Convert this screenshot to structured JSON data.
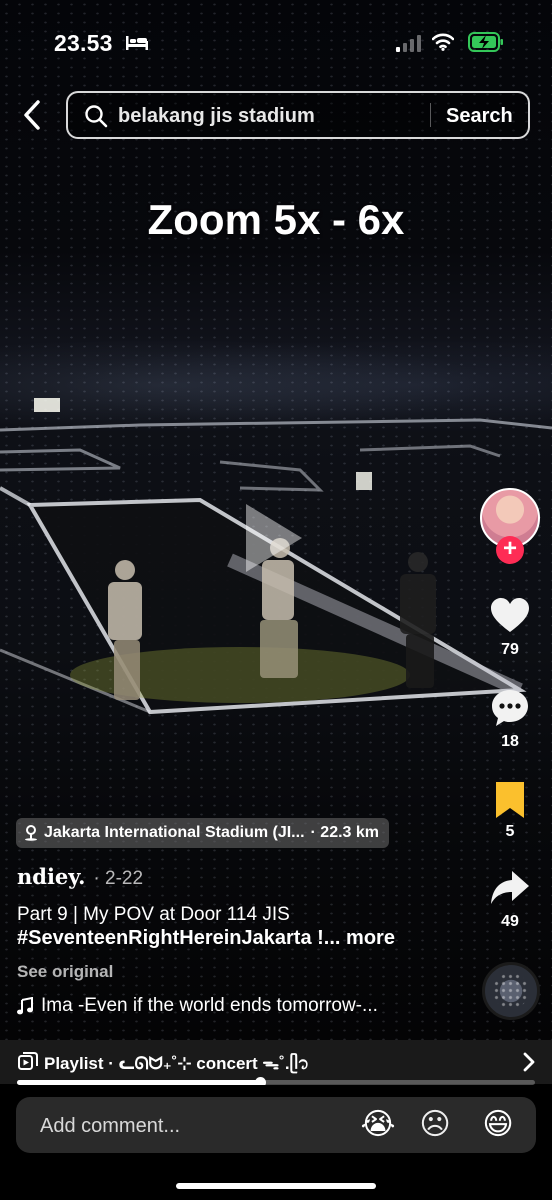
{
  "status_bar": {
    "time": "23.53",
    "icons": [
      "bed-icon",
      "signal-icon",
      "wifi-icon",
      "battery-charging-icon"
    ]
  },
  "search": {
    "query": "belakang jis stadium",
    "button_label": "Search"
  },
  "video": {
    "overlay_text": "Zoom 5x - 6x"
  },
  "actions": {
    "likes": "79",
    "comments": "18",
    "saves": "5",
    "shares": "49"
  },
  "post": {
    "location": "Jakarta International Stadium (JI...",
    "distance": "· 22.3 km",
    "author": "ndiey.",
    "date": "· 2-22",
    "caption_line1": "Part 9 | My POV at Door 114 JIS",
    "caption_line2": "#SeventeenRightHereinJakarta !...",
    "more_label": "more",
    "see_original": "See original",
    "music": "Ima -Even if the world ends tomorrow-..."
  },
  "playlist": {
    "label": "Playlist · ᓚᘏᗢ₊˚⊹ concert ᯓ˚.ᥫ᭡"
  },
  "playback": {
    "progress": 0.47
  },
  "comment_bar": {
    "placeholder": "Add comment...",
    "emojis": [
      "😭",
      "☹",
      "😄"
    ]
  },
  "colors": {
    "accent": "#fe2c55",
    "save_active": "#fbc02d",
    "battery": "#34c759"
  }
}
